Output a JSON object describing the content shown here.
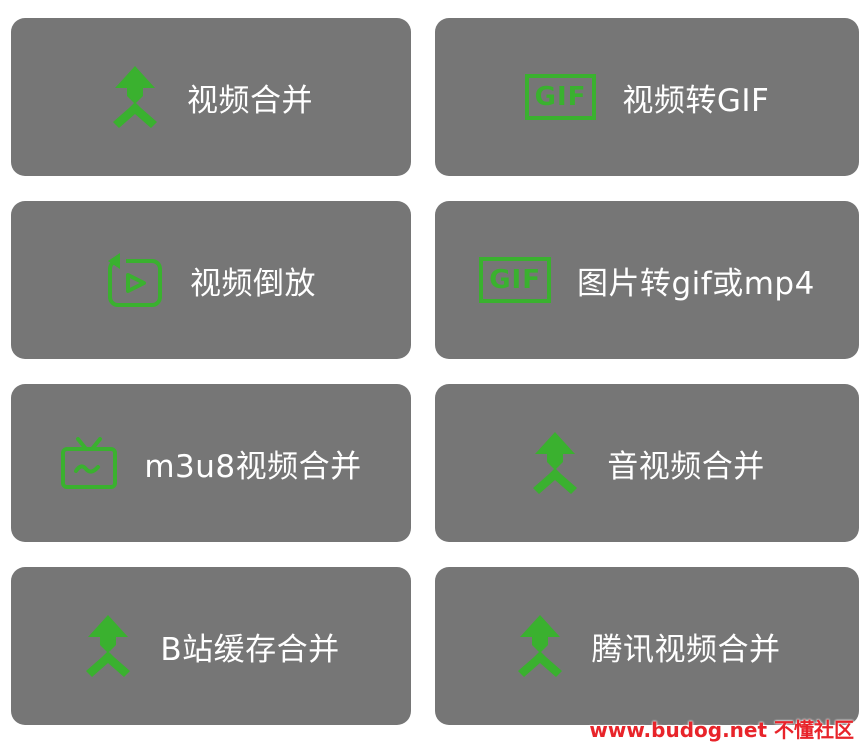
{
  "tiles": [
    {
      "label": "视频合并",
      "icon": "merge-arrow-icon"
    },
    {
      "label": "视频转GIF",
      "icon": "gif-icon",
      "icon_text": "GIF"
    },
    {
      "label": "视频倒放",
      "icon": "reverse-play-icon"
    },
    {
      "label": "图片转gif或mp4",
      "icon": "gif-icon",
      "icon_text": "GIF"
    },
    {
      "label": "m3u8视频合并",
      "icon": "tv-icon"
    },
    {
      "label": "音视频合并",
      "icon": "merge-arrow-icon"
    },
    {
      "label": "B站缓存合并",
      "icon": "merge-arrow-icon"
    },
    {
      "label": "腾讯视频合并",
      "icon": "merge-arrow-icon"
    }
  ],
  "watermark": "www.budog.net 不懂社区",
  "colors": {
    "tile_bg": "#767676",
    "icon_green": "#3ab12f",
    "label_text": "#ffffff",
    "watermark": "#e8242a"
  }
}
